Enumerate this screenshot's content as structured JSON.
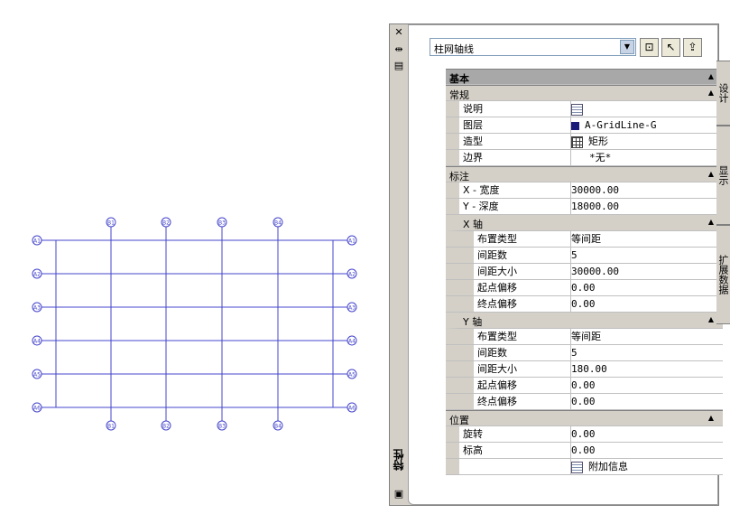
{
  "drawing": {
    "top_bubbles": [
      "B1",
      "B2",
      "B3",
      "B4"
    ],
    "bottom_bubbles": [
      "B1",
      "B2",
      "B3",
      "B4"
    ],
    "left_bubbles": [
      "A1",
      "A2",
      "A3",
      "A4",
      "A5",
      "A6"
    ],
    "right_bubbles": [
      "A1",
      "A2",
      "A3",
      "A4",
      "A5",
      "A6"
    ],
    "line_color": "#4444cc"
  },
  "palette": {
    "title": "特性",
    "object_type": "柱网轴线",
    "tabs": [
      "设计",
      "显示",
      "扩展数据"
    ],
    "rows": [
      {
        "kind": "cat-top",
        "label": "基本"
      },
      {
        "kind": "cat",
        "label": "常规"
      },
      {
        "kind": "prop",
        "level": 1,
        "label": "说明",
        "value": "",
        "icon": "note"
      },
      {
        "kind": "prop",
        "level": 1,
        "label": "图层",
        "value": "A-GridLine-G",
        "icon": "layer",
        "icon_color": "#1a1a7a"
      },
      {
        "kind": "prop",
        "level": 1,
        "label": "造型",
        "value": "矩形",
        "icon": "grid"
      },
      {
        "kind": "prop",
        "level": 1,
        "label": "边界",
        "value": "*无*"
      },
      {
        "kind": "cat",
        "label": "标注"
      },
      {
        "kind": "prop",
        "level": 1,
        "label": "X - 宽度",
        "value": "30000.00"
      },
      {
        "kind": "prop",
        "level": 1,
        "label": "Y - 深度",
        "value": "18000.00"
      },
      {
        "kind": "sub",
        "label": "X 轴"
      },
      {
        "kind": "prop",
        "level": 2,
        "label": "布置类型",
        "value": "等间距"
      },
      {
        "kind": "prop",
        "level": 2,
        "label": "间距数",
        "value": "5"
      },
      {
        "kind": "prop",
        "level": 2,
        "label": "间距大小",
        "value": "30000.00"
      },
      {
        "kind": "prop",
        "level": 2,
        "label": "起点偏移",
        "value": "0.00"
      },
      {
        "kind": "prop",
        "level": 2,
        "label": "终点偏移",
        "value": "0.00"
      },
      {
        "kind": "sub",
        "label": "Y 轴"
      },
      {
        "kind": "prop",
        "level": 2,
        "label": "布置类型",
        "value": "等间距"
      },
      {
        "kind": "prop",
        "level": 2,
        "label": "间距数",
        "value": "5"
      },
      {
        "kind": "prop",
        "level": 2,
        "label": "间距大小",
        "value": "180.00"
      },
      {
        "kind": "prop",
        "level": 2,
        "label": "起点偏移",
        "value": "0.00"
      },
      {
        "kind": "prop",
        "level": 2,
        "label": "终点偏移",
        "value": "0.00"
      },
      {
        "kind": "cat",
        "label": "位置"
      },
      {
        "kind": "prop",
        "level": 1,
        "label": "旋转",
        "value": "0.00"
      },
      {
        "kind": "prop",
        "level": 1,
        "label": "标高",
        "value": "0.00"
      },
      {
        "kind": "prop",
        "level": 1,
        "label": "",
        "value": "附加信息",
        "icon": "note"
      }
    ]
  }
}
